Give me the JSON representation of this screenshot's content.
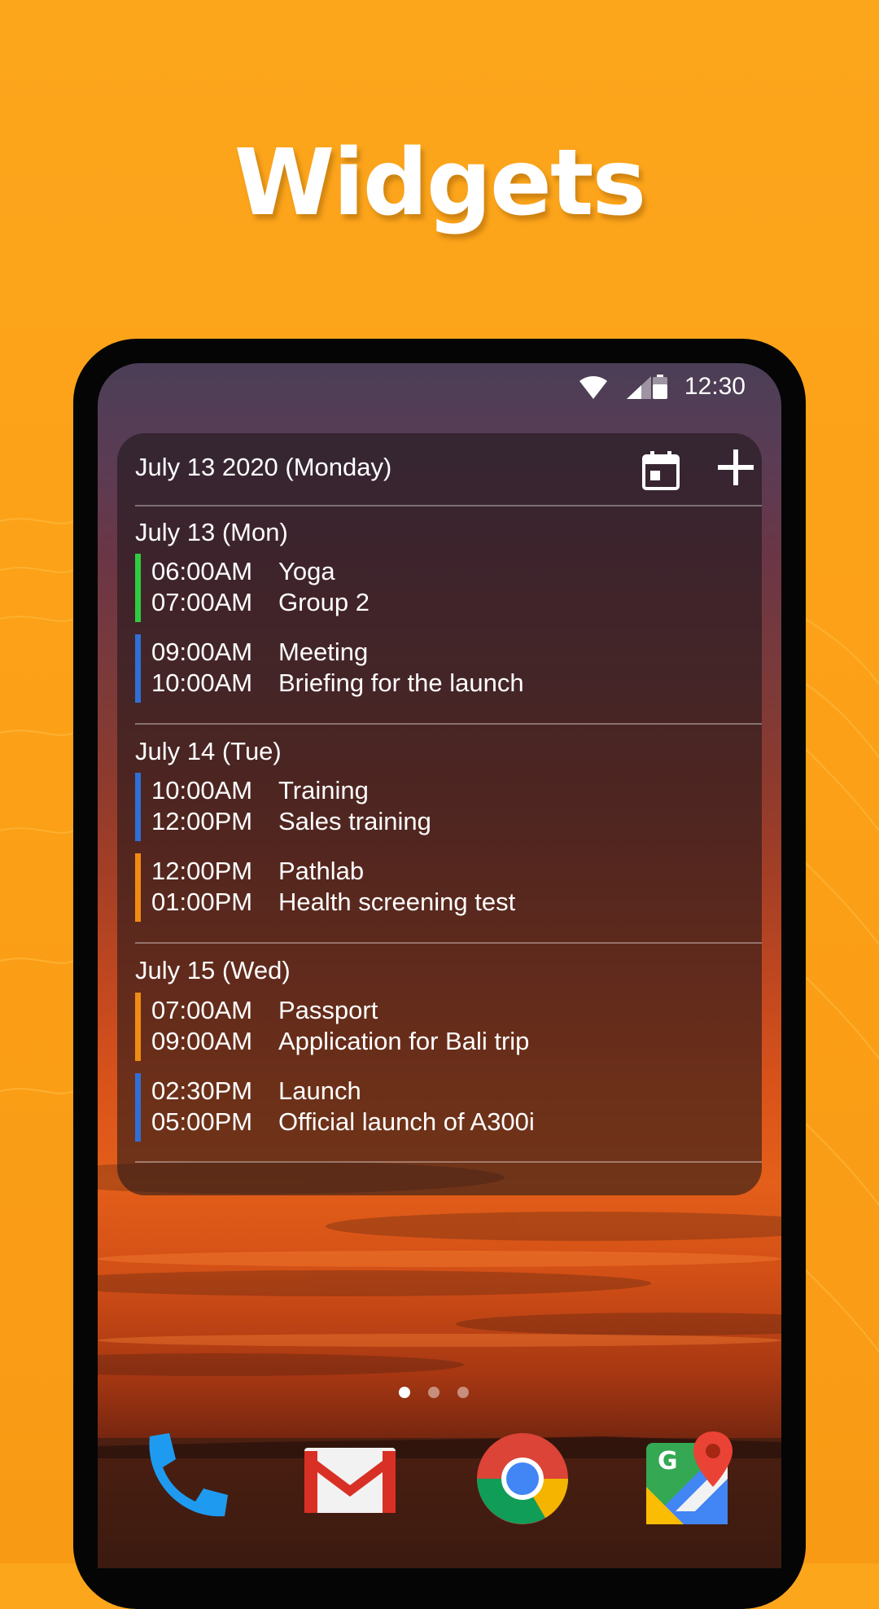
{
  "headline": "Widgets",
  "status": {
    "time": "12:30"
  },
  "widget": {
    "header_date": "July 13 2020 (Monday)",
    "days": [
      {
        "label": "July 13 (Mon)",
        "events": [
          {
            "start": "06:00AM",
            "end": "07:00AM",
            "title": "Yoga",
            "desc": "Group 2",
            "color": "#2ecc40"
          },
          {
            "start": "09:00AM",
            "end": "10:00AM",
            "title": "Meeting",
            "desc": "Briefing for the launch",
            "color": "#2f6fd6"
          }
        ]
      },
      {
        "label": "July 14 (Tue)",
        "events": [
          {
            "start": "10:00AM",
            "end": "12:00PM",
            "title": "Training",
            "desc": "Sales training",
            "color": "#2f6fd6"
          },
          {
            "start": "12:00PM",
            "end": "01:00PM",
            "title": "Pathlab",
            "desc": "Health screening test",
            "color": "#f08c14"
          }
        ]
      },
      {
        "label": "July 15 (Wed)",
        "events": [
          {
            "start": "07:00AM",
            "end": "09:00AM",
            "title": "Passport",
            "desc": "Application for Bali trip",
            "color": "#f08c14"
          },
          {
            "start": "02:30PM",
            "end": "05:00PM",
            "title": "Launch",
            "desc": "Official launch of A300i",
            "color": "#2f6fd6"
          }
        ]
      }
    ]
  },
  "icons": {
    "calendar": "calendar-icon",
    "add": "plus-icon",
    "wifi": "wifi-icon",
    "signal": "cell-signal-icon",
    "battery": "battery-icon",
    "dock": [
      "phone-icon",
      "gmail-icon",
      "chrome-icon",
      "maps-icon"
    ]
  },
  "page_indicator": {
    "count": 3,
    "active": 0
  },
  "colors": {
    "background": "#fca61c",
    "accent_green": "#2ecc40",
    "accent_blue": "#2f6fd6",
    "accent_orange": "#f08c14"
  }
}
